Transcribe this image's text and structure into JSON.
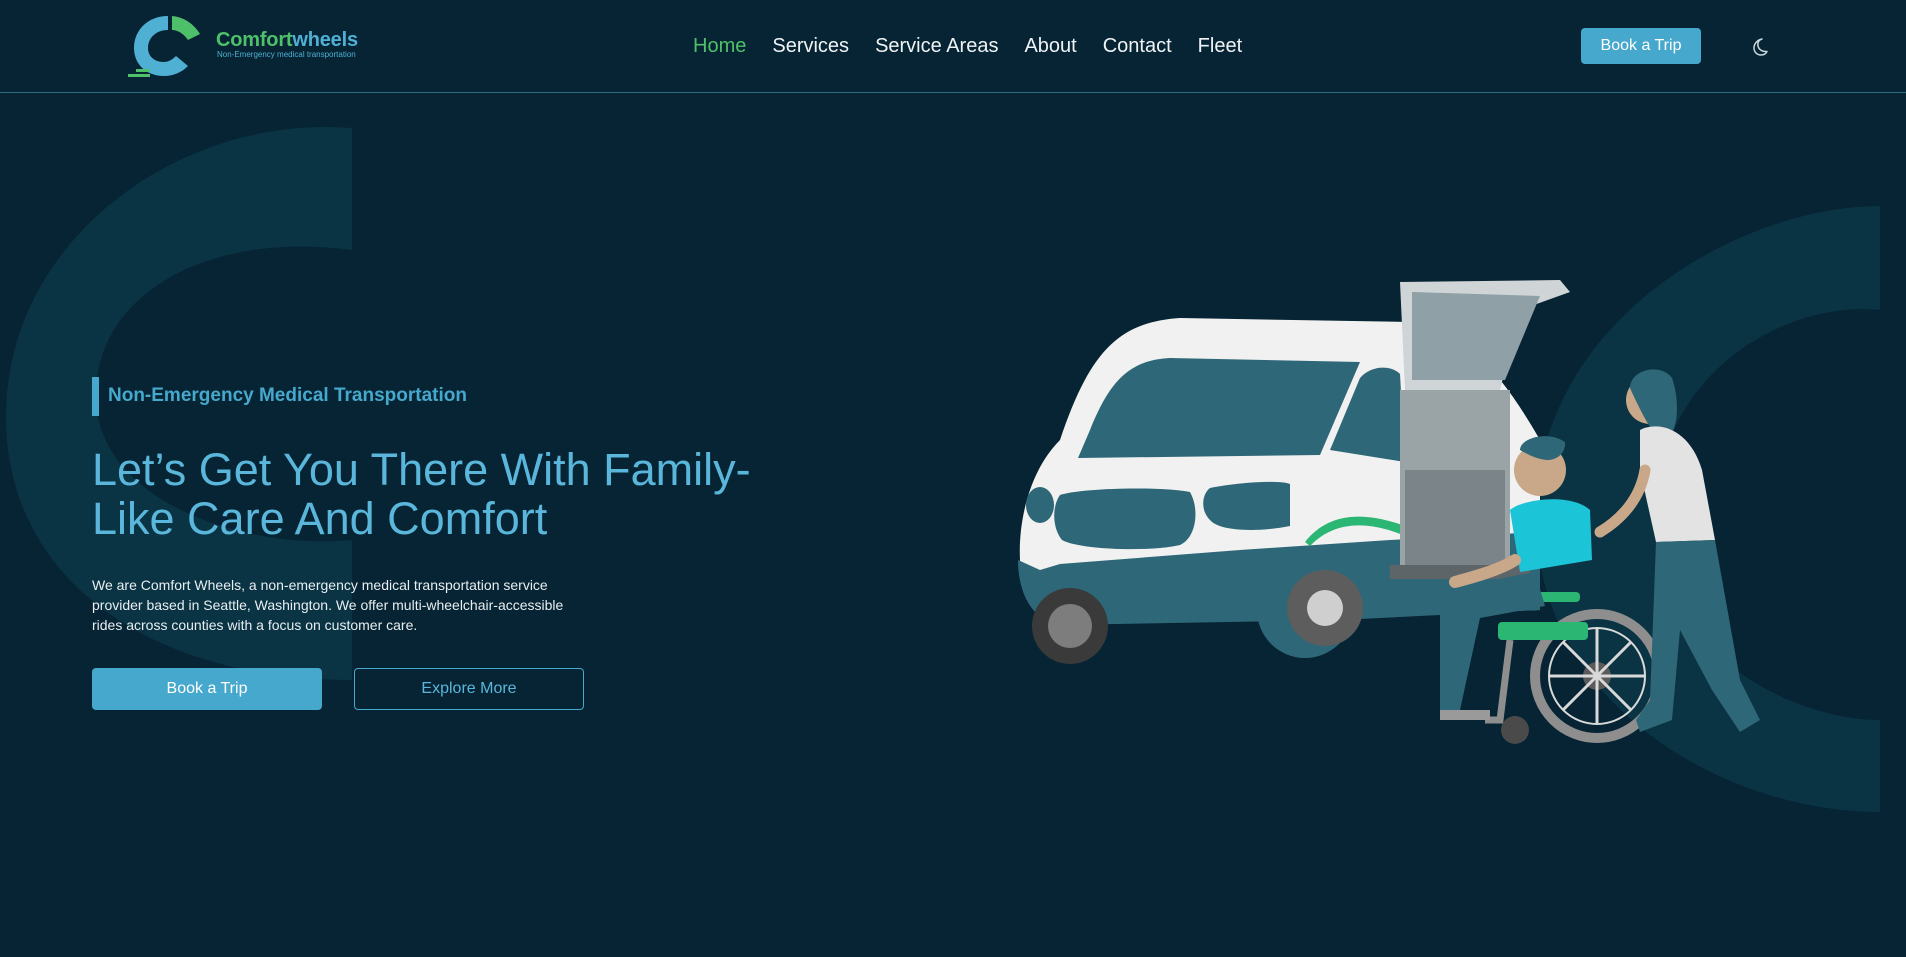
{
  "brand": {
    "name_part1": "Comfort",
    "name_part2": "wheels",
    "tagline": "Non-Emergency medical transportation",
    "colors": {
      "green": "#4fc06a",
      "blue": "#4fb0d4",
      "background": "#062433"
    }
  },
  "nav": {
    "items": [
      {
        "label": "Home",
        "active": true
      },
      {
        "label": "Services",
        "active": false
      },
      {
        "label": "Service Areas",
        "active": false
      },
      {
        "label": "About",
        "active": false
      },
      {
        "label": "Contact",
        "active": false
      },
      {
        "label": "Fleet",
        "active": false
      }
    ],
    "book_label": "Book a Trip",
    "theme_icon": "moon-icon"
  },
  "hero": {
    "eyebrow": "Non-Emergency Medical Transportation",
    "headline": "Let’s Get You There With Family-Like Care And Comfort",
    "description": "We are Comfort Wheels, a non-emergency medical transportation service provider based in Seattle, Washington. We offer multi-wheelchair-accessible rides across counties with a focus on customer care.",
    "primary_cta": "Book a Trip",
    "secondary_cta": "Explore More",
    "illustration": "wheelchair-van-illustration"
  }
}
